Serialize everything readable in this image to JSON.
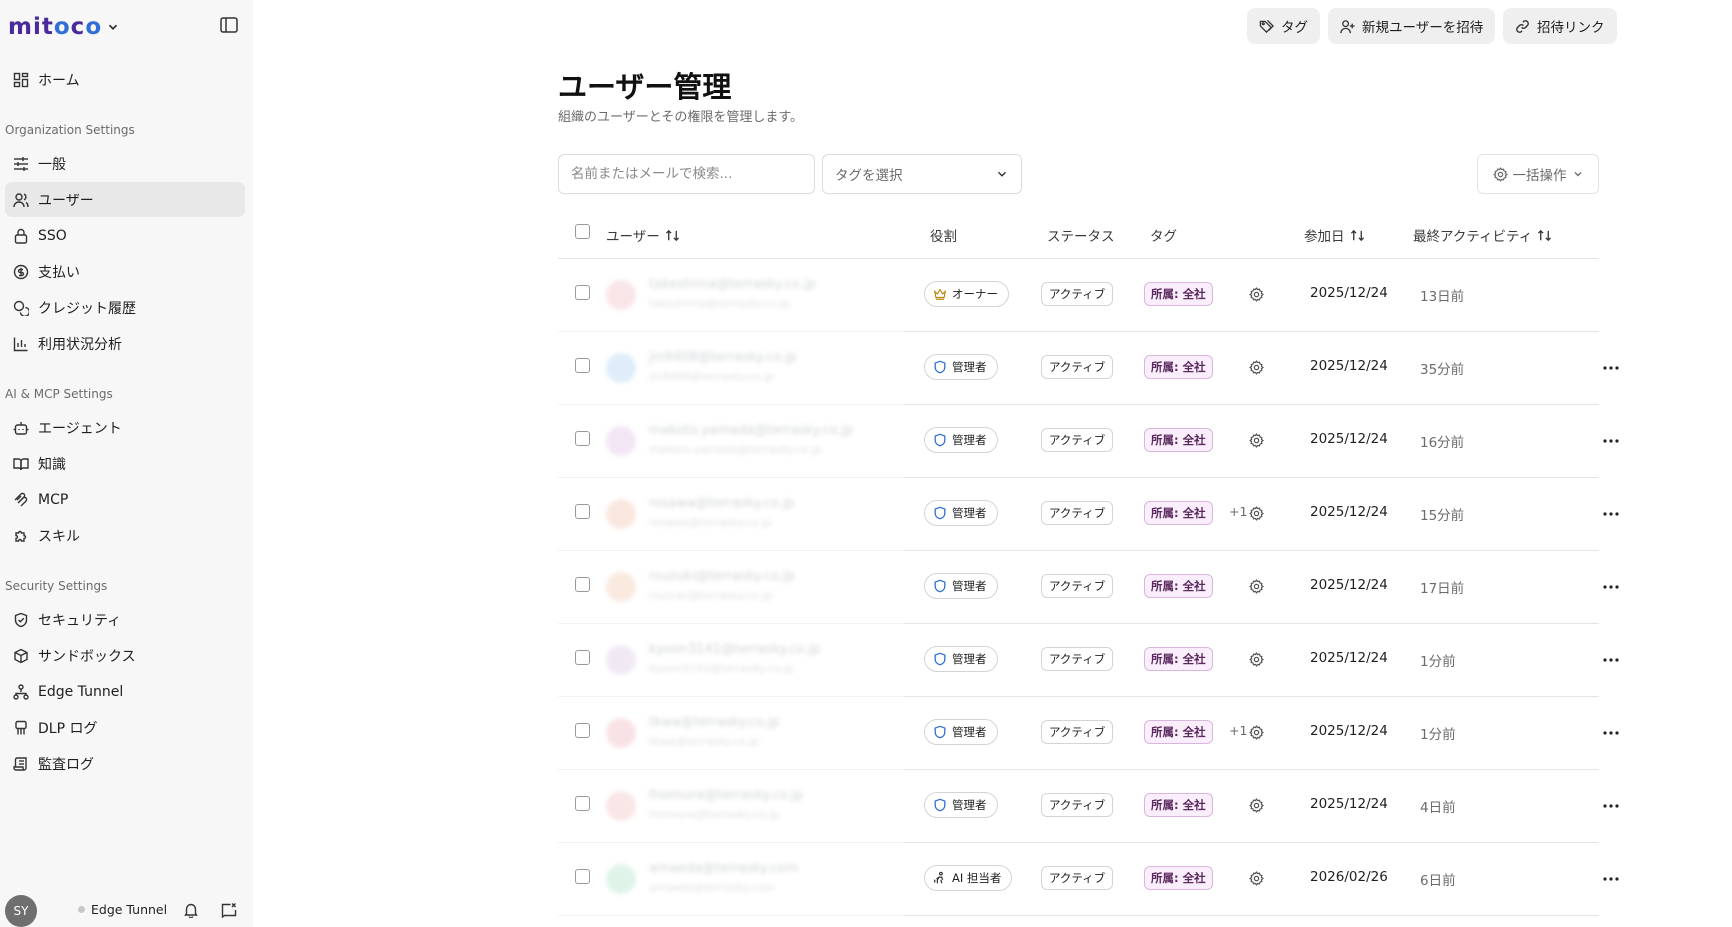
{
  "app": {
    "logo_text": "mitoco"
  },
  "sidebar": {
    "home_label": "ホーム",
    "sections": [
      {
        "label": "Organization Settings"
      },
      {
        "label": "AI & MCP Settings"
      },
      {
        "label": "Security Settings"
      }
    ],
    "items": [
      {
        "label": "一般",
        "icon": "sliders-icon"
      },
      {
        "label": "ユーザー",
        "icon": "users-icon"
      },
      {
        "label": "SSO",
        "icon": "lock-icon"
      },
      {
        "label": "支払い",
        "icon": "dollar-icon"
      },
      {
        "label": "クレジット履歴",
        "icon": "coins-icon"
      },
      {
        "label": "利用状況分析",
        "icon": "bar-chart-icon"
      },
      {
        "label": "エージェント",
        "icon": "bot-icon"
      },
      {
        "label": "知識",
        "icon": "book-icon"
      },
      {
        "label": "MCP",
        "icon": "mcp-icon"
      },
      {
        "label": "スキル",
        "icon": "puzzle-icon"
      },
      {
        "label": "セキュリティ",
        "icon": "shield-check-icon"
      },
      {
        "label": "サンドボックス",
        "icon": "box-icon"
      },
      {
        "label": "Edge Tunnel",
        "icon": "network-icon"
      },
      {
        "label": "DLP ログ",
        "icon": "dlp-icon"
      },
      {
        "label": "監査ログ",
        "icon": "scroll-icon"
      }
    ],
    "footer": {
      "avatar_initials": "SY",
      "tunnel_label": "Edge Tunnel"
    }
  },
  "header": {
    "tag_button": "タグ",
    "invite_button": "新規ユーザーを招待",
    "invite_link_button": "招待リンク"
  },
  "page": {
    "title": "ユーザー管理",
    "subtitle": "組織のユーザーとその権限を管理します。"
  },
  "filters": {
    "search_placeholder": "名前またはメールで検索...",
    "tag_select_placeholder": "タグを選択",
    "bulk_action_label": "一括操作"
  },
  "table": {
    "columns": {
      "user": "ユーザー",
      "role": "役割",
      "status": "ステータス",
      "tags": "タグ",
      "joined": "参加日",
      "last_active": "最終アクティビティ"
    },
    "rows": [
      {
        "email": "takeshima@terrasky.co.jp",
        "role": "オーナー",
        "role_type": "owner",
        "status": "アクティブ",
        "tag": "所属: 全社",
        "tag_more": "",
        "joined": "2025/12/24",
        "last_active": "13日前",
        "has_menu": false
      },
      {
        "email": "jin9408@terrasky.co.jp",
        "role": "管理者",
        "role_type": "admin",
        "status": "アクティブ",
        "tag": "所属: 全社",
        "tag_more": "",
        "joined": "2025/12/24",
        "last_active": "35分前",
        "has_menu": true
      },
      {
        "email": "makoto.yamada@terrasky.co.jp",
        "role": "管理者",
        "role_type": "admin",
        "status": "アクティブ",
        "tag": "所属: 全社",
        "tag_more": "",
        "joined": "2025/12/24",
        "last_active": "16分前",
        "has_menu": true
      },
      {
        "email": "rosawa@terrasky.co.jp",
        "role": "管理者",
        "role_type": "admin",
        "status": "アクティブ",
        "tag": "所属: 全社",
        "tag_more": "+1",
        "joined": "2025/12/24",
        "last_active": "15分前",
        "has_menu": true
      },
      {
        "email": "rsuzuki@terrasky.co.jp",
        "role": "管理者",
        "role_type": "admin",
        "status": "アクティブ",
        "tag": "所属: 全社",
        "tag_more": "",
        "joined": "2025/12/24",
        "last_active": "17日前",
        "has_menu": true
      },
      {
        "email": "kyoon3141@terrasky.co.jp",
        "role": "管理者",
        "role_type": "admin",
        "status": "アクティブ",
        "tag": "所属: 全社",
        "tag_more": "",
        "joined": "2025/12/24",
        "last_active": "1分前",
        "has_menu": true
      },
      {
        "email": "tkwa@terrasky.co.jp",
        "role": "管理者",
        "role_type": "admin",
        "status": "アクティブ",
        "tag": "所属: 全社",
        "tag_more": "+1",
        "joined": "2025/12/24",
        "last_active": "1分前",
        "has_menu": true
      },
      {
        "email": "fnomura@terrasky.co.jp",
        "role": "管理者",
        "role_type": "admin",
        "status": "アクティブ",
        "tag": "所属: 全社",
        "tag_more": "",
        "joined": "2025/12/24",
        "last_active": "4日前",
        "has_menu": true
      },
      {
        "email": "amaeda@terrasky.com",
        "role": "AI 担当者",
        "role_type": "ai",
        "status": "アクティブ",
        "tag": "所属: 全社",
        "tag_more": "",
        "joined": "2026/02/26",
        "last_active": "6日前",
        "has_menu": true
      }
    ]
  },
  "colors": {
    "sidebar_bg": "#f7f7f7",
    "active_item_bg": "#e8e8e8",
    "tag_bg": "#fbeefc",
    "tag_border": "#d9b6dd",
    "admin_icon": "#2f6fd6",
    "owner_icon": "#b8860b"
  }
}
